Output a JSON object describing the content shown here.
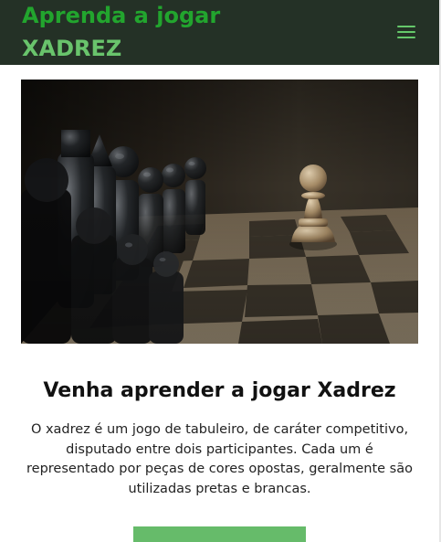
{
  "header": {
    "title_line1": "Aprenda a jogar",
    "title_line2": "XADREZ",
    "menu_icon": "hamburger-menu-icon",
    "background_color": "#243126",
    "title_color_primary": "#22a52e",
    "title_color_secondary": "#69c46c"
  },
  "hero": {
    "image_subject": "chess-board-pieces-photo"
  },
  "content": {
    "headline": "Venha aprender a jogar Xadrez",
    "description": "O xadrez é um jogo de tabuleiro, de caráter competitivo, disputado entre dois participantes. Cada um é representado por peças de cores opostas, geralmente são utilizadas pretas e brancas."
  },
  "cta": {
    "label": "",
    "color": "#66bb6a"
  }
}
